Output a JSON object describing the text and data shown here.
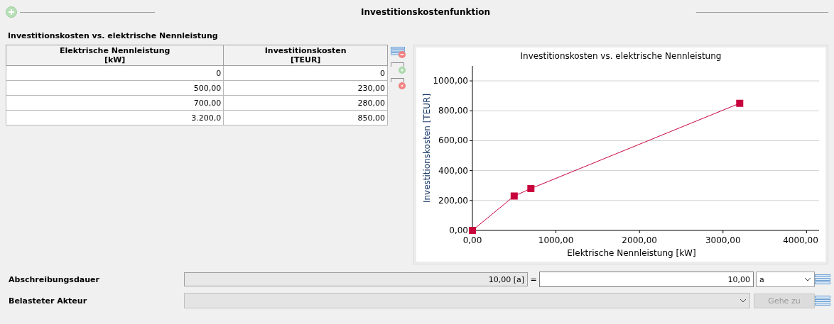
{
  "header": {
    "title": "Investitionskostenfunktion"
  },
  "section": {
    "title": "Investitionskosten vs. elektrische Nennleistung"
  },
  "table": {
    "columns": [
      {
        "label": "Elektrische Nennleistung",
        "unit": "[kW]"
      },
      {
        "label": "Investitionskosten",
        "unit": "[TEUR]"
      }
    ],
    "rows": [
      [
        "0",
        "0"
      ],
      [
        "500,00",
        "230,00"
      ],
      [
        "700,00",
        "280,00"
      ],
      [
        "3.200,0",
        "850,00"
      ]
    ]
  },
  "chart_data": {
    "type": "line",
    "title": "Investitionskosten vs. elektrische Nennleistung",
    "xlabel": "Elektrische Nennleistung [kW]",
    "ylabel": "Investitionskosten [TEUR]",
    "x": [
      0,
      500,
      700,
      3200
    ],
    "series": [
      {
        "color": "#c8003c",
        "marker": "square",
        "values": [
          0,
          230,
          280,
          850
        ]
      }
    ],
    "grid": true,
    "xlim": [
      0,
      4150
    ],
    "ylim": [
      0,
      1100
    ],
    "xticks": [
      {
        "value": 0,
        "label": "0,00"
      },
      {
        "value": 1000,
        "label": "1000,00"
      },
      {
        "value": 2000,
        "label": "2000,00"
      },
      {
        "value": 3000,
        "label": "3000,00"
      },
      {
        "value": 4000,
        "label": "4000,00"
      }
    ],
    "yticks": [
      {
        "value": 0,
        "label": "0,00"
      },
      {
        "value": 200,
        "label": "200,00"
      },
      {
        "value": 400,
        "label": "400,00"
      },
      {
        "value": 600,
        "label": "600,00"
      },
      {
        "value": 800,
        "label": "800,00"
      },
      {
        "value": 1000,
        "label": "1000,00"
      }
    ]
  },
  "depreciation": {
    "label": "Abschreibungsdauer",
    "computed": "10,00 [a]",
    "equals": "=",
    "value": "10,00",
    "unit": "a"
  },
  "actor": {
    "label": "Belasteter Akteur",
    "button": "Gehe zu",
    "button_disabled": true
  }
}
